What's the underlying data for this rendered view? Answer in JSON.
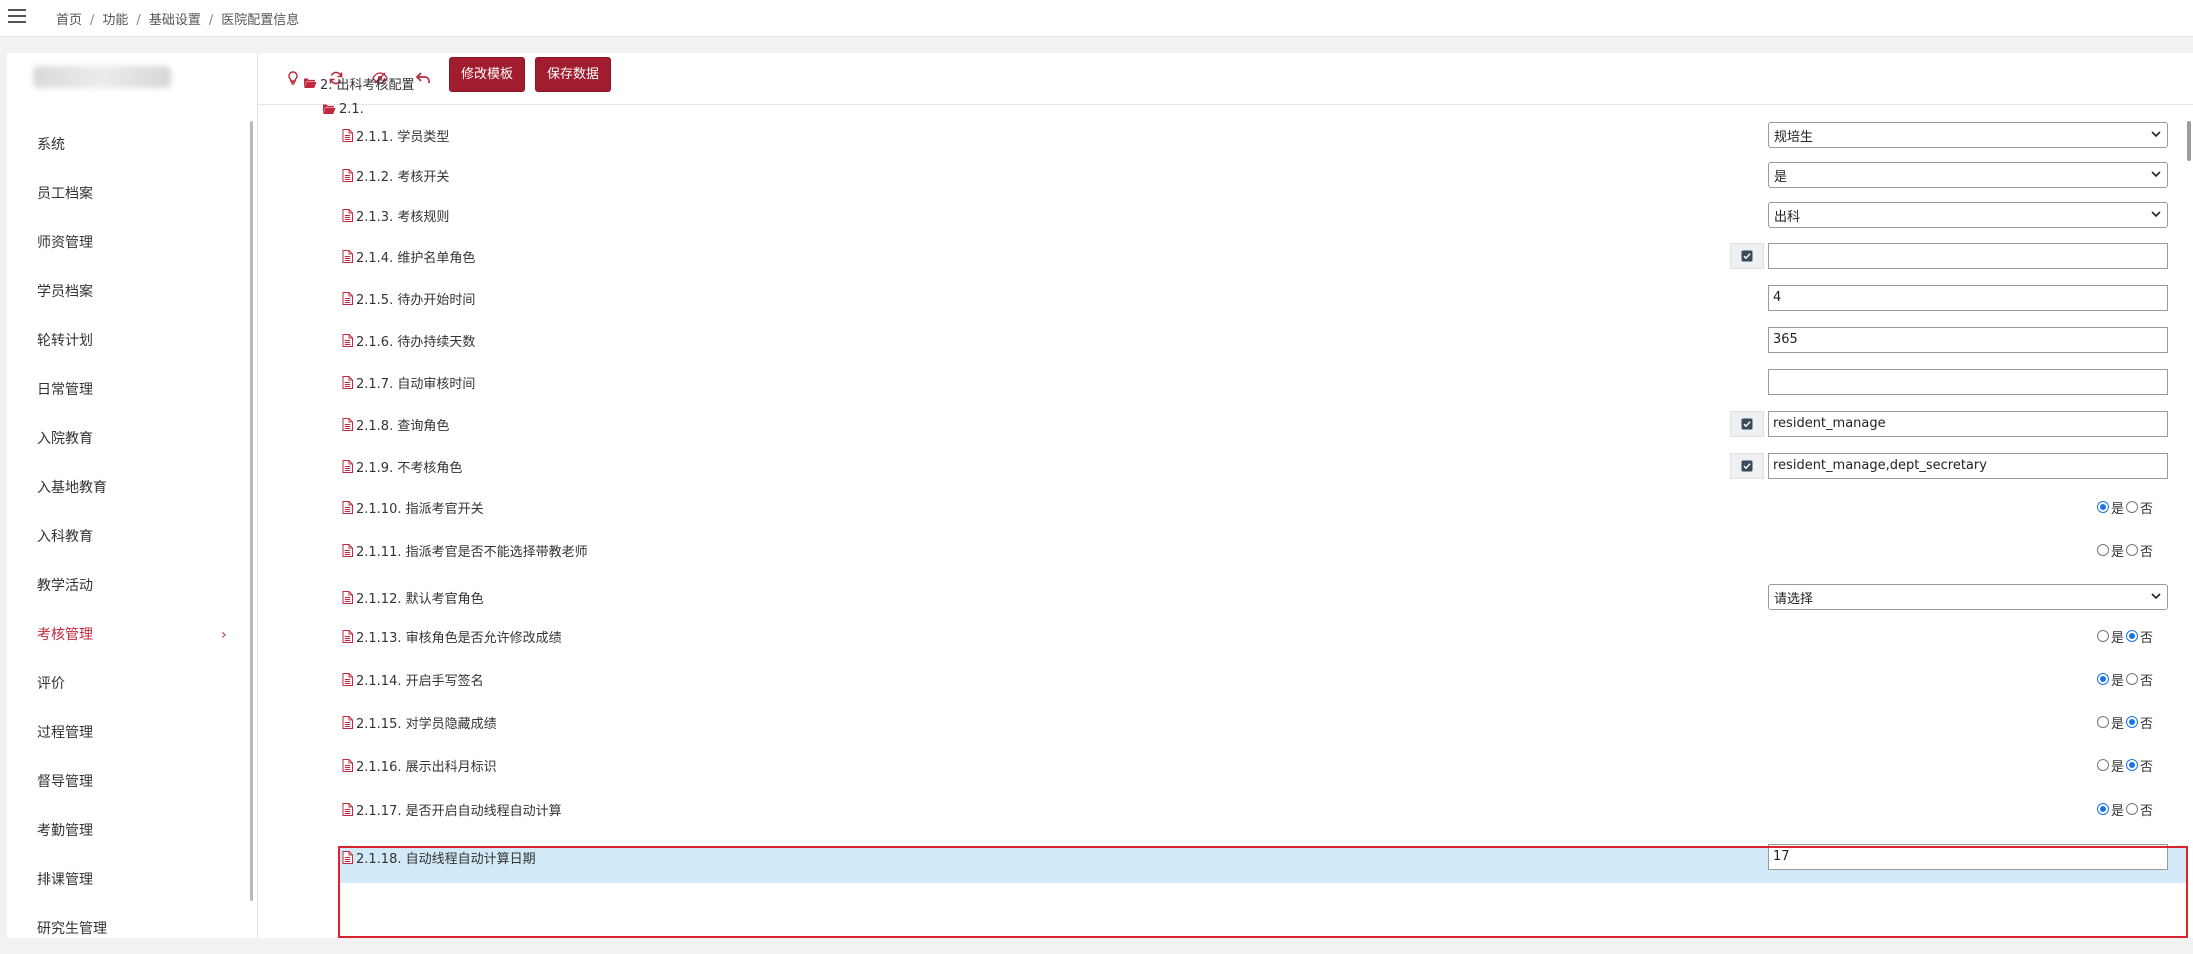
{
  "breadcrumb": [
    "首页",
    "功能",
    "基础设置",
    "医院配置信息"
  ],
  "sidebar": {
    "items": [
      {
        "label": "系统",
        "active": false
      },
      {
        "label": "员工档案",
        "active": false
      },
      {
        "label": "师资管理",
        "active": false
      },
      {
        "label": "学员档案",
        "active": false
      },
      {
        "label": "轮转计划",
        "active": false
      },
      {
        "label": "日常管理",
        "active": false
      },
      {
        "label": "入院教育",
        "active": false
      },
      {
        "label": "入基地教育",
        "active": false
      },
      {
        "label": "入科教育",
        "active": false
      },
      {
        "label": "教学活动",
        "active": false
      },
      {
        "label": "考核管理",
        "active": true,
        "chevron": "›"
      },
      {
        "label": "评价",
        "active": false
      },
      {
        "label": "过程管理",
        "active": false
      },
      {
        "label": "督导管理",
        "active": false
      },
      {
        "label": "考勤管理",
        "active": false
      },
      {
        "label": "排课管理",
        "active": false
      },
      {
        "label": "研究生管理",
        "active": false
      }
    ]
  },
  "toolbar": {
    "icons": [
      "lightbulb-icon",
      "refresh-icon",
      "eye-slash-icon",
      "undo-icon"
    ],
    "edit_template_label": "修改模板",
    "save_data_label": "保存数据"
  },
  "tree": {
    "section": "2. 出科考核配置",
    "subsection": "2.1.",
    "rows": [
      {
        "label": "2.1.1. 学员类型",
        "type": "select",
        "value": "规培生"
      },
      {
        "label": "2.1.2. 考核开关",
        "type": "select",
        "value": "是"
      },
      {
        "label": "2.1.3. 考核规则",
        "type": "select",
        "value": "出科"
      },
      {
        "label": "2.1.4. 维护名单角色",
        "type": "input-check",
        "value": ""
      },
      {
        "label": "2.1.5. 待办开始时间",
        "type": "input",
        "value": "4"
      },
      {
        "label": "2.1.6. 待办持续天数",
        "type": "input",
        "value": "365"
      },
      {
        "label": "2.1.7. 自动审核时间",
        "type": "input",
        "value": ""
      },
      {
        "label": "2.1.8. 查询角色",
        "type": "input-check",
        "value": "resident_manage"
      },
      {
        "label": "2.1.9. 不考核角色",
        "type": "input-check",
        "value": "resident_manage,dept_secretary"
      },
      {
        "label": "2.1.10. 指派考官开关",
        "type": "radio",
        "selected": "yes"
      },
      {
        "label": "2.1.11. 指派考官是否不能选择带教老师",
        "type": "radio",
        "selected": "none"
      },
      {
        "label": "2.1.12. 默认考官角色",
        "type": "select",
        "value": "请选择"
      },
      {
        "label": "2.1.13. 审核角色是否允许修改成绩",
        "type": "radio",
        "selected": "no"
      },
      {
        "label": "2.1.14. 开启手写签名",
        "type": "radio",
        "selected": "yes"
      },
      {
        "label": "2.1.15. 对学员隐藏成绩",
        "type": "radio",
        "selected": "no"
      },
      {
        "label": "2.1.16. 展示出科月标识",
        "type": "radio",
        "selected": "no"
      },
      {
        "label": "2.1.17. 是否开启自动线程自动计算",
        "type": "radio",
        "selected": "yes",
        "highlighted": true
      },
      {
        "label": "2.1.18. 自动线程自动计算日期",
        "type": "input",
        "value": "17"
      }
    ],
    "radio_yes": "是",
    "radio_no": "否"
  },
  "colors": {
    "accent": "#a01c2e",
    "active_menu": "#c0293f",
    "highlight_row": "#d2e9f7",
    "annotation_box": "#d9232d",
    "radio_checked": "#1a73e8"
  }
}
